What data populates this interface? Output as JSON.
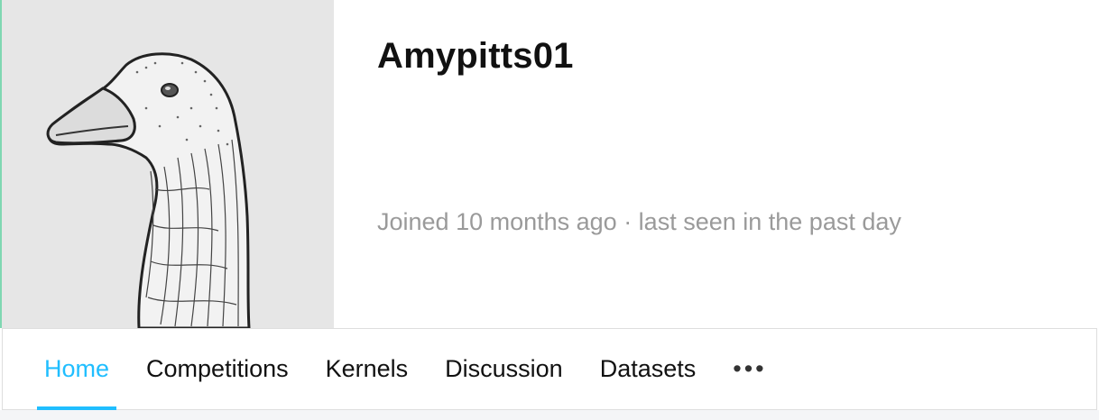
{
  "profile": {
    "username": "Amypitts01",
    "joined_text": "Joined 10 months ago · last seen in the past day",
    "avatar_icon": "goose-illustration"
  },
  "tabs": [
    {
      "label": "Home",
      "active": true
    },
    {
      "label": "Competitions",
      "active": false
    },
    {
      "label": "Kernels",
      "active": false
    },
    {
      "label": "Discussion",
      "active": false
    },
    {
      "label": "Datasets",
      "active": false
    }
  ],
  "more_icon": "more-horizontal-icon",
  "more_label": "•••",
  "colors": {
    "accent": "#20beff",
    "left_accent": "#7fd7b2",
    "avatar_bg": "#e6e6e6",
    "muted_text": "#9a9a9a"
  }
}
